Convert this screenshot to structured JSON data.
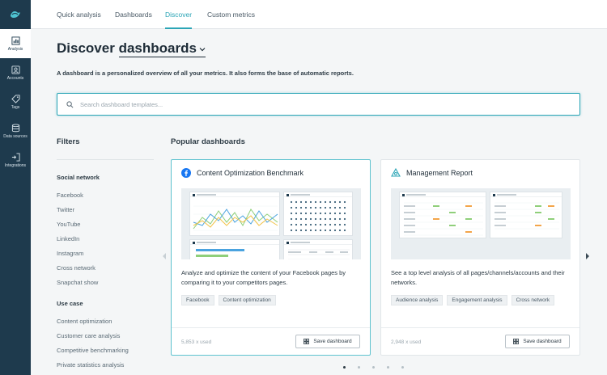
{
  "sidebar": {
    "items": [
      {
        "label": "Analysis",
        "icon": "bar-chart-icon",
        "active": true
      },
      {
        "label": "Accounts",
        "icon": "accounts-icon"
      },
      {
        "label": "Tags",
        "icon": "tag-icon"
      },
      {
        "label": "Data sources",
        "icon": "database-icon"
      },
      {
        "label": "Integrations",
        "icon": "integrations-icon"
      }
    ]
  },
  "topnav": {
    "tabs": [
      {
        "label": "Quick analysis"
      },
      {
        "label": "Dashboards"
      },
      {
        "label": "Discover",
        "active": true
      },
      {
        "label": "Custom metrics"
      }
    ]
  },
  "header": {
    "title_prefix": "Discover",
    "title_dropdown": "dashboards",
    "subtitle": "A dashboard is a personalized overview of all your metrics. It also forms the base of automatic reports."
  },
  "search": {
    "placeholder": "Search dashboard templates...",
    "value": ""
  },
  "filters": {
    "title": "Filters",
    "groups": [
      {
        "label": "Social network",
        "items": [
          "Facebook",
          "Twitter",
          "YouTube",
          "LinkedIn",
          "Instagram",
          "Cross network",
          "Snapchat show"
        ]
      },
      {
        "label": "Use case",
        "items": [
          "Content optimization",
          "Customer care analysis",
          "Competitive benchmarking",
          "Private statistics analysis"
        ]
      }
    ]
  },
  "popular": {
    "title": "Popular dashboards",
    "cards": [
      {
        "title": "Content Optimization Benchmark",
        "icon": "facebook-icon",
        "description": "Analyze and optimize the content of your Facebook pages by comparing it to your competitors pages.",
        "tags": [
          "Facebook",
          "Content optimization"
        ],
        "used": "5,853 x used",
        "save_label": "Save dashboard"
      },
      {
        "title": "Management Report",
        "icon": "management-report-icon",
        "description": "See a top level analysis of all pages/channels/accounts and their networks.",
        "tags": [
          "Audience analysis",
          "Engagement analysis",
          "Cross network"
        ],
        "used": "2,948 x used",
        "save_label": "Save dashboard"
      }
    ]
  },
  "pagination": {
    "count": 5,
    "active": 0
  },
  "colors": {
    "accent": "#2ba5b6",
    "sidebar": "#1e3a4d",
    "facebook": "#1877f2"
  }
}
